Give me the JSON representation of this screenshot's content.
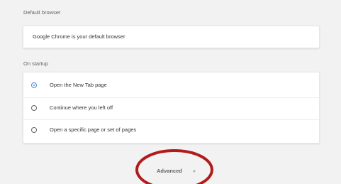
{
  "default_browser": {
    "section_title": "Default browser",
    "status_text": "Google Chrome is your default browser"
  },
  "on_startup": {
    "section_title": "On startup",
    "options": [
      {
        "label": "Open the New Tab page",
        "selected": true
      },
      {
        "label": "Continue where you left off",
        "selected": false
      },
      {
        "label": "Open a specific page or set of pages",
        "selected": false
      }
    ]
  },
  "advanced": {
    "label": "Advanced",
    "icon": "chevron-down-icon"
  },
  "colors": {
    "accent": "#4a86e8",
    "highlight_ring": "#b01c1c",
    "background": "#f2f2f2"
  }
}
